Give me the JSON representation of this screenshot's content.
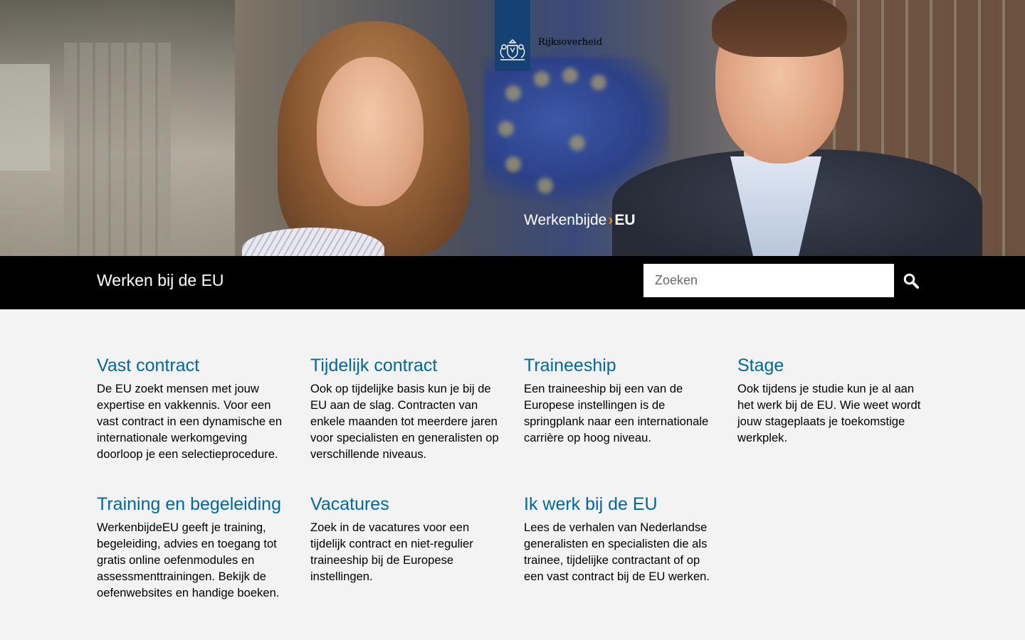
{
  "hero": {
    "logo_text": "Rijksoverheid",
    "brand": {
      "part1": "Werkenbijde",
      "chevron": "›",
      "part2": "EU"
    }
  },
  "navbar": {
    "site_title": "Werken bij de EU",
    "search": {
      "placeholder": "Zoeken",
      "value": "",
      "button_icon": "search-icon"
    }
  },
  "cards": [
    {
      "title": "Vast contract",
      "text": "De EU zoekt mensen met jouw expertise en vakkennis. Voor een vast contract in een dynamische en internationale werkomgeving doorloop je een selectieprocedure."
    },
    {
      "title": "Tijdelijk contract",
      "text": "Ook op tijdelijke basis kun je bij de EU aan de slag. Contracten van enkele maanden tot meerdere jaren voor specialisten en generalisten op verschillende niveaus."
    },
    {
      "title": "Traineeship",
      "text": "Een traineeship bij een van de Europese instellingen is de springplank naar een internationale carrière op hoog niveau."
    },
    {
      "title": "Stage",
      "text": "Ook tijdens je studie kun je al aan het werk bij de EU. Wie weet wordt jouw stageplaats je toekomstige werkplek."
    },
    {
      "title": "Training en begeleiding",
      "text": "WerkenbijdeEU geeft je training, begeleiding, advies en toegang tot gratis online oefenmodules en assessmenttrainingen. Bekijk de oefenwebsites en handige boeken."
    },
    {
      "title": "Vacatures",
      "text": "Zoek in de vacatures voor een tijdelijk contract en niet-regulier traineeship bij de Europese instellingen."
    },
    {
      "title": "Ik werk bij de EU",
      "text": "Lees de verhalen van Nederlandse generalisten en specialisten die als trainee, tijdelijke contractant of op een vast contract bij de EU werken."
    }
  ],
  "colors": {
    "logo_blue": "#154273",
    "link_blue": "#01689b",
    "brand_orange": "#f39200",
    "navbar_bg": "#000000",
    "page_bg": "#f3f3f3"
  }
}
